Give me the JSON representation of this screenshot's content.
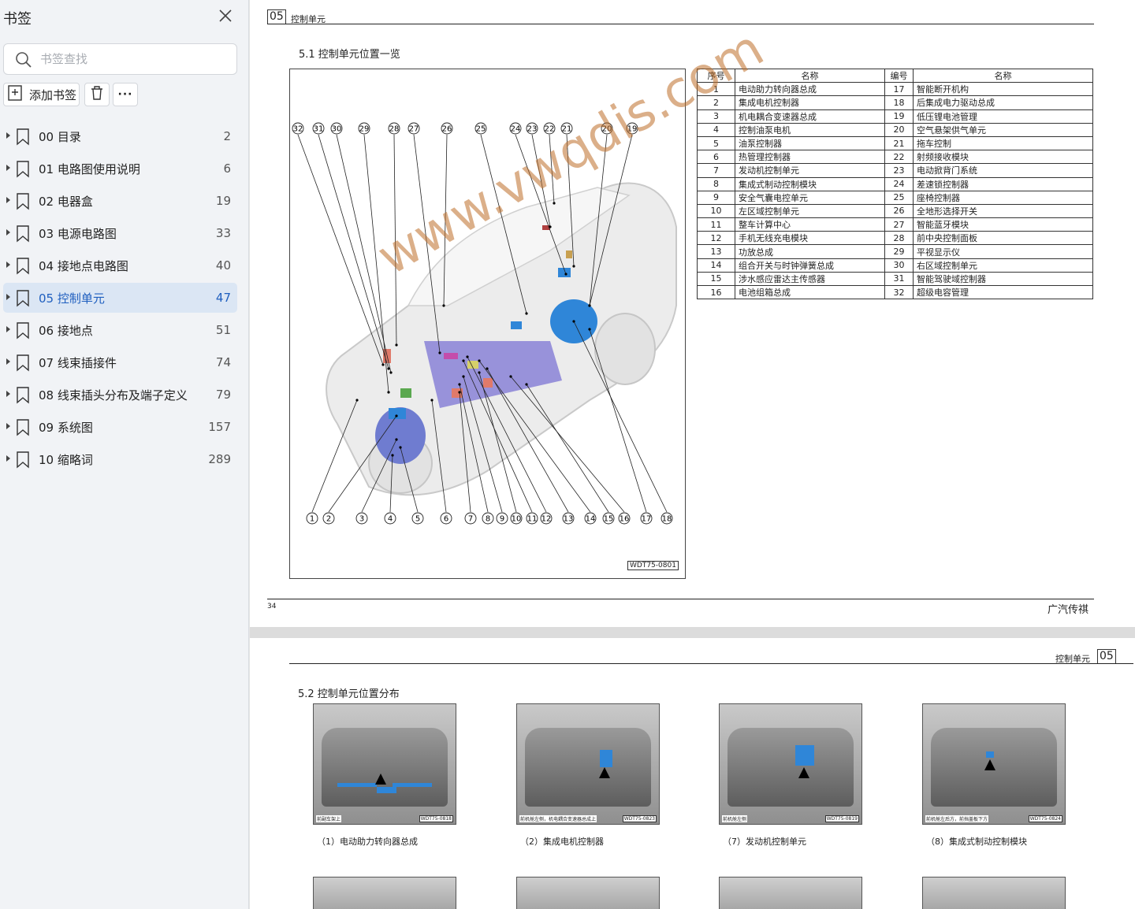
{
  "sidebar": {
    "title": "书签",
    "search_placeholder": "书签查找",
    "add_bookmark_label": "添加书签",
    "more_label": "···",
    "items": [
      {
        "label": "00 目录",
        "page": "2"
      },
      {
        "label": "01 电路图使用说明",
        "page": "6"
      },
      {
        "label": "02 电器盒",
        "page": "19"
      },
      {
        "label": "03 电源电路图",
        "page": "33"
      },
      {
        "label": "04 接地点电路图",
        "page": "40"
      },
      {
        "label": "05 控制单元",
        "page": "47",
        "active": true
      },
      {
        "label": "06 接地点",
        "page": "51"
      },
      {
        "label": "07 线束插接件",
        "page": "74"
      },
      {
        "label": "08 线束插头分布及端子定义",
        "page": "79"
      },
      {
        "label": "09 系统图",
        "page": "157"
      },
      {
        "label": "10 缩略词",
        "page": "289"
      }
    ]
  },
  "page1": {
    "section_number": "05",
    "section_title": "控制单元",
    "subheading": "5.1 控制单元位置一览",
    "figure_code": "WDT75-0801",
    "callouts_top": [
      "32",
      "31",
      "30",
      "29",
      "28",
      "27",
      "26",
      "25",
      "24",
      "23",
      "22",
      "21",
      "20",
      "19"
    ],
    "callouts_bottom": [
      "1",
      "2",
      "3",
      "4",
      "5",
      "6",
      "7",
      "8",
      "9",
      "10",
      "11",
      "12",
      "13",
      "14",
      "15",
      "16",
      "17",
      "18"
    ],
    "table": {
      "headers": [
        "序号",
        "名称",
        "编号",
        "名称"
      ],
      "rows": [
        [
          "1",
          "电动助力转向器总成",
          "17",
          "智能断开机构"
        ],
        [
          "2",
          "集成电机控制器",
          "18",
          "后集成电力驱动总成"
        ],
        [
          "3",
          "机电耦合变速器总成",
          "19",
          "低压锂电池管理"
        ],
        [
          "4",
          "控制油泵电机",
          "20",
          "空气悬架供气单元"
        ],
        [
          "5",
          "油泵控制器",
          "21",
          "拖车控制"
        ],
        [
          "6",
          "热管理控制器",
          "22",
          "射频接收模块"
        ],
        [
          "7",
          "发动机控制单元",
          "23",
          "电动掀背门系统"
        ],
        [
          "8",
          "集成式制动控制模块",
          "24",
          "差速锁控制器"
        ],
        [
          "9",
          "安全气囊电控单元",
          "25",
          "座椅控制器"
        ],
        [
          "10",
          "左区域控制单元",
          "26",
          "全地形选择开关"
        ],
        [
          "11",
          "整车计算中心",
          "27",
          "智能蓝牙模块"
        ],
        [
          "12",
          "手机无线充电模块",
          "28",
          "前中央控制面板"
        ],
        [
          "13",
          "功放总成",
          "29",
          "平视显示仪"
        ],
        [
          "14",
          "组合开关与时钟弹簧总成",
          "30",
          "右区域控制单元"
        ],
        [
          "15",
          "涉水感应雷达主传感器",
          "31",
          "智能驾驶域控制器"
        ],
        [
          "16",
          "电池组箱总成",
          "32",
          "超级电容管理"
        ]
      ]
    },
    "watermark": "www.vwqdis.com",
    "page_number": "34",
    "footer_brand": "广汽传祺"
  },
  "page2": {
    "section_number": "05",
    "section_title": "控制单元",
    "subheading": "5.2 控制单元位置分布",
    "photos": [
      {
        "caption": "（1）电动助力转向器总成",
        "img_caption": "前副车架上",
        "code": "WDT75-0818"
      },
      {
        "caption": "（2）集成电机控制器",
        "img_caption": "前机舱左侧，机电耦合变速器总成上",
        "code": "WDT75-0823"
      },
      {
        "caption": "（7）发动机控制单元",
        "img_caption": "前机舱左侧",
        "code": "WDT75-0819"
      },
      {
        "caption": "（8）集成式制动控制模块",
        "img_caption": "前机舱左后方，前挡盖板下方",
        "code": "WDT75-0824"
      }
    ]
  },
  "colors": {
    "sidebar_bg": "#f1f3f6",
    "active_item_bg": "#dbe6f4",
    "active_item_text": "#1f5fbf",
    "component_blue": "#2f86d8",
    "watermark": "#be6e28"
  }
}
